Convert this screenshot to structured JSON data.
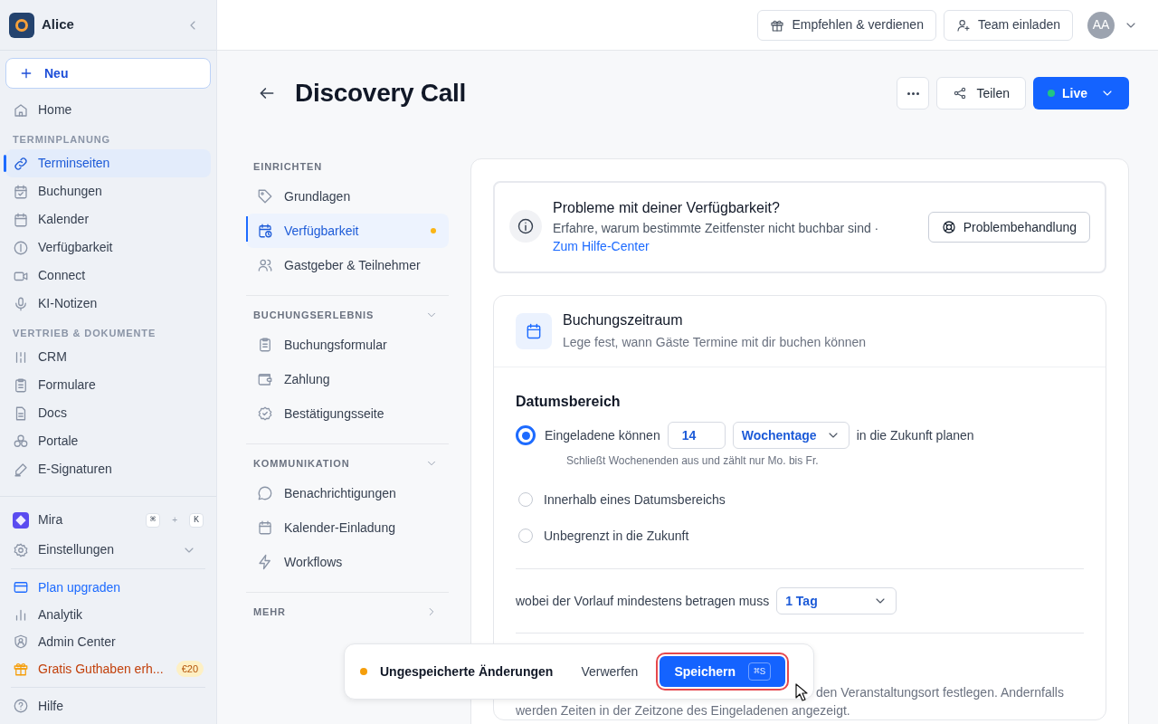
{
  "sidebar": {
    "workspace": "Alice",
    "new_button": "Neu",
    "nav": [
      {
        "kind": "item",
        "label": "Home",
        "selected": false
      },
      {
        "kind": "heading",
        "label": "TERMINPLANUNG"
      },
      {
        "kind": "item",
        "label": "Terminseiten",
        "selected": true
      },
      {
        "kind": "item",
        "label": "Buchungen",
        "selected": false
      },
      {
        "kind": "item",
        "label": "Kalender",
        "selected": false
      },
      {
        "kind": "item",
        "label": "Verfügbarkeit",
        "selected": false
      },
      {
        "kind": "item",
        "label": "Connect",
        "selected": false
      },
      {
        "kind": "item",
        "label": "KI-Notizen",
        "selected": false
      },
      {
        "kind": "heading",
        "label": "VERTRIEB & DOKUMENTE"
      },
      {
        "kind": "item",
        "label": "CRM",
        "selected": false
      },
      {
        "kind": "item",
        "label": "Formulare",
        "selected": false
      },
      {
        "kind": "item",
        "label": "Docs",
        "selected": false
      },
      {
        "kind": "item",
        "label": "Portale",
        "selected": false
      },
      {
        "kind": "item",
        "label": "E-Signaturen",
        "selected": false
      }
    ],
    "assistant": {
      "label": "Mira",
      "keys": [
        "⌘",
        "K"
      ],
      "joiner": "+"
    },
    "settings": {
      "label": "Einstellungen"
    },
    "bottom": [
      {
        "kind": "upgrade",
        "label": "Plan upgraden"
      },
      {
        "kind": "plain",
        "label": "Analytik"
      },
      {
        "kind": "plain",
        "label": "Admin Center"
      },
      {
        "kind": "promo",
        "label": "Gratis Guthaben erh...",
        "badge": "€20"
      }
    ],
    "help": "Hilfe"
  },
  "topbar": {
    "buttons": [
      "Empfehlen & verdienen",
      "Team einladen"
    ],
    "avatar": "AA"
  },
  "page": {
    "title": "Discovery Call",
    "share": "Teilen",
    "status": "Live"
  },
  "settings_nav": [
    {
      "title": "EINRICHTEN",
      "items": [
        {
          "label": "Grundlagen",
          "selected": false,
          "modified": false
        },
        {
          "label": "Verfügbarkeit",
          "selected": true,
          "modified": true
        },
        {
          "label": "Gastgeber & Teilnehmer",
          "selected": false,
          "modified": false
        }
      ]
    },
    {
      "title": "BUCHUNGSERLEBNIS",
      "expanded": true,
      "items": [
        {
          "label": "Buchungsformular",
          "selected": false,
          "modified": false
        },
        {
          "label": "Zahlung",
          "selected": false,
          "modified": false
        },
        {
          "label": "Bestätigungsseite",
          "selected": false,
          "modified": false
        }
      ]
    },
    {
      "title": "KOMMUNIKATION",
      "expanded": true,
      "items": [
        {
          "label": "Benachrichtigungen",
          "selected": false,
          "modified": false
        },
        {
          "label": "Kalender-Einladung",
          "selected": false,
          "modified": false
        },
        {
          "label": "Workflows",
          "selected": false,
          "modified": false
        }
      ]
    },
    {
      "title": "MEHR",
      "expanded": false
    }
  ],
  "alert": {
    "title": "Probleme mit deiner Verfügbarkeit?",
    "text": "Erfahre, warum bestimmte Zeitfenster nicht buchbar sind ·",
    "link": "Zum Hilfe-Center",
    "button": "Problembehandlung"
  },
  "booking_window": {
    "title": "Buchungszeitraum",
    "subtitle": "Lege fest, wann Gäste Termine mit dir buchen können",
    "date_range": {
      "heading": "Datumsbereich",
      "options": [
        {
          "kind": "rolling",
          "selected": true,
          "prefix": "Eingeladene können",
          "value": "14",
          "unit": "Wochentage",
          "suffix": "in die Zukunft planen",
          "hint": "Schließt Wochenenden aus und zählt nur Mo. bis Fr."
        },
        {
          "kind": "simple",
          "selected": false,
          "label": "Innerhalb eines Datumsbereichs"
        },
        {
          "kind": "simple",
          "selected": false,
          "label": "Unbegrenzt in die Zukunft"
        }
      ]
    },
    "notice": {
      "label": "wobei der Vorlauf mindestens betragen muss",
      "value": "1 Tag"
    },
    "timezone_note": [
      "den Veranstaltungsort festlegen. Andernfalls",
      "werden Zeiten in der Zeitzone des Eingeladenen angezeigt."
    ]
  },
  "toast": {
    "status": "Ungespeicherte Änderungen",
    "discard": "Verwerfen",
    "save": "Speichern",
    "shortcut": "⌘S"
  }
}
